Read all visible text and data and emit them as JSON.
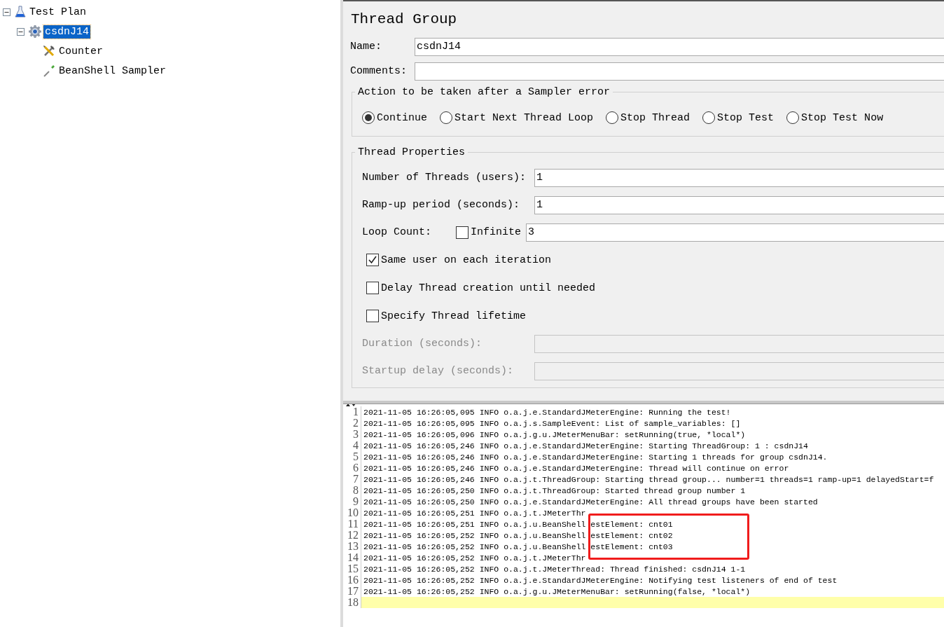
{
  "tree": [
    {
      "label": "Test Plan",
      "kind": "plan",
      "expanded": true,
      "selected": false,
      "children": [
        {
          "label": "csdnJ14",
          "kind": "thread-group",
          "expanded": true,
          "selected": true,
          "children": [
            {
              "label": "Counter",
              "kind": "config",
              "selected": false
            },
            {
              "label": "BeanShell Sampler",
              "kind": "sampler",
              "selected": false
            }
          ]
        }
      ]
    }
  ],
  "form": {
    "title": "Thread Group",
    "name": {
      "label": "Name:",
      "value": "csdnJ14"
    },
    "comments": {
      "label": "Comments:"
    },
    "action_group": {
      "legend": "Action to be taken after a Sampler error",
      "options": [
        {
          "label": "Continue",
          "selected": true
        },
        {
          "label": "Start Next Thread Loop",
          "selected": false
        },
        {
          "label": "Stop Thread",
          "selected": false
        },
        {
          "label": "Stop Test",
          "selected": false
        },
        {
          "label": "Stop Test Now",
          "selected": false
        }
      ]
    },
    "properties": {
      "legend": "Thread Properties",
      "rows": [
        {
          "kind": "field",
          "label": "Number of Threads (users):",
          "value": "1",
          "disabled": false
        },
        {
          "kind": "field",
          "label": "Ramp-up period (seconds):",
          "value": "1",
          "disabled": false
        },
        {
          "kind": "loop",
          "label": "Loop Count:",
          "checkbox": "Infinite",
          "checked": false,
          "value": "3",
          "disabled": false
        },
        {
          "kind": "check",
          "label": "Same user on each iteration",
          "checked": true
        },
        {
          "kind": "check",
          "label": "Delay Thread creation until needed",
          "checked": false
        },
        {
          "kind": "check",
          "label": "Specify Thread lifetime",
          "checked": false
        },
        {
          "kind": "field",
          "label": "Duration (seconds):",
          "disabled": true
        },
        {
          "kind": "field",
          "label": "Startup delay (seconds):",
          "disabled": true
        }
      ]
    }
  },
  "log": {
    "lines": [
      {
        "number": "1",
        "text": "2021-11-05 16:26:05,095 INFO o.a.j.e.StandardJMeterEngine: Running the test!",
        "current": false
      },
      {
        "number": "2",
        "text": "2021-11-05 16:26:05,095 INFO o.a.j.s.SampleEvent: List of sample_variables: []",
        "current": false
      },
      {
        "number": "3",
        "text": "2021-11-05 16:26:05,096 INFO o.a.j.g.u.JMeterMenuBar: setRunning(true, *local*)",
        "current": false
      },
      {
        "number": "4",
        "text": "2021-11-05 16:26:05,246 INFO o.a.j.e.StandardJMeterEngine: Starting ThreadGroup: 1 : csdnJ14",
        "current": false
      },
      {
        "number": "5",
        "text": "2021-11-05 16:26:05,246 INFO o.a.j.e.StandardJMeterEngine: Starting 1 threads for group csdnJ14.",
        "current": false
      },
      {
        "number": "6",
        "text": "2021-11-05 16:26:05,246 INFO o.a.j.e.StandardJMeterEngine: Thread will continue on error",
        "current": false
      },
      {
        "number": "7",
        "text": "2021-11-05 16:26:05,246 INFO o.a.j.t.ThreadGroup: Starting thread group... number=1 threads=1 ramp-up=1 delayedStart=f",
        "current": false
      },
      {
        "number": "8",
        "text": "2021-11-05 16:26:05,250 INFO o.a.j.t.ThreadGroup: Started thread group number 1",
        "current": false
      },
      {
        "number": "9",
        "text": "2021-11-05 16:26:05,250 INFO o.a.j.e.StandardJMeterEngine: All thread groups have been started",
        "current": false
      },
      {
        "number": "10",
        "text": "2021-11-05 16:26:05,251 INFO o.a.j.t.JMeterThr",
        "current": false
      },
      {
        "number": "11",
        "text": "2021-11-05 16:26:05,251 INFO o.a.j.u.BeanShell",
        "text_2": "estElement: cnt01",
        "current": false
      },
      {
        "number": "12",
        "text": "2021-11-05 16:26:05,252 INFO o.a.j.u.BeanShell",
        "text_2": "estElement: cnt02",
        "current": false
      },
      {
        "number": "13",
        "text": "2021-11-05 16:26:05,252 INFO o.a.j.u.BeanShell",
        "text_2": "estElement: cnt03",
        "current": false
      },
      {
        "number": "14",
        "text": "2021-11-05 16:26:05,252 INFO o.a.j.t.JMeterThr",
        "current": false
      },
      {
        "number": "15",
        "text": "2021-11-05 16:26:05,252 INFO o.a.j.t.JMeterThread: Thread finished: csdnJ14 1-1",
        "current": false
      },
      {
        "number": "16",
        "text": "2021-11-05 16:26:05,252 INFO o.a.j.e.StandardJMeterEngine: Notifying test listeners of end of test",
        "current": false
      },
      {
        "number": "17",
        "text": "2021-11-05 16:26:05,252 INFO o.a.j.g.u.JMeterMenuBar: setRunning(false, *local*)",
        "current": false
      },
      {
        "number": "18",
        "current": true
      }
    ]
  }
}
